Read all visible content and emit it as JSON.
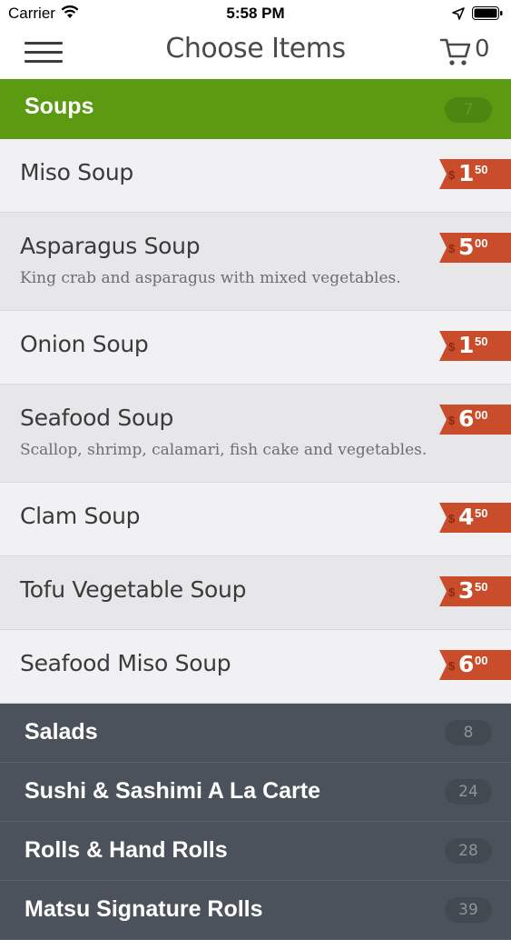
{
  "status_bar": {
    "carrier": "Carrier",
    "time": "5:58 PM"
  },
  "nav": {
    "title": "Choose Items",
    "cart_count": "0",
    "menu_icon": "hamburger-icon",
    "cart_icon": "cart-icon"
  },
  "colors": {
    "active_header": "#5c9a12",
    "price_tag": "#c94d2b",
    "category_bg": "#4b525c"
  },
  "active_category": {
    "name": "Soups",
    "count": "7"
  },
  "items": [
    {
      "name": "Miso Soup",
      "description": "",
      "currency": "$",
      "price_whole": "1",
      "price_cents": "50"
    },
    {
      "name": "Asparagus Soup",
      "description": "King crab and asparagus with mixed vegetables.",
      "currency": "$",
      "price_whole": "5",
      "price_cents": "00"
    },
    {
      "name": "Onion Soup",
      "description": "",
      "currency": "$",
      "price_whole": "1",
      "price_cents": "50"
    },
    {
      "name": "Seafood Soup",
      "description": "Scallop, shrimp, calamari, fish cake and vegetables.",
      "currency": "$",
      "price_whole": "6",
      "price_cents": "00"
    },
    {
      "name": "Clam Soup",
      "description": "",
      "currency": "$",
      "price_whole": "4",
      "price_cents": "50"
    },
    {
      "name": "Tofu Vegetable Soup",
      "description": "",
      "currency": "$",
      "price_whole": "3",
      "price_cents": "50"
    },
    {
      "name": "Seafood Miso Soup",
      "description": "",
      "currency": "$",
      "price_whole": "6",
      "price_cents": "00"
    }
  ],
  "other_categories": [
    {
      "name": "Salads",
      "count": "8"
    },
    {
      "name": "Sushi & Sashimi A La Carte",
      "count": "24"
    },
    {
      "name": "Rolls & Hand Rolls",
      "count": "28"
    },
    {
      "name": "Matsu Signature Rolls",
      "count": "39"
    }
  ]
}
